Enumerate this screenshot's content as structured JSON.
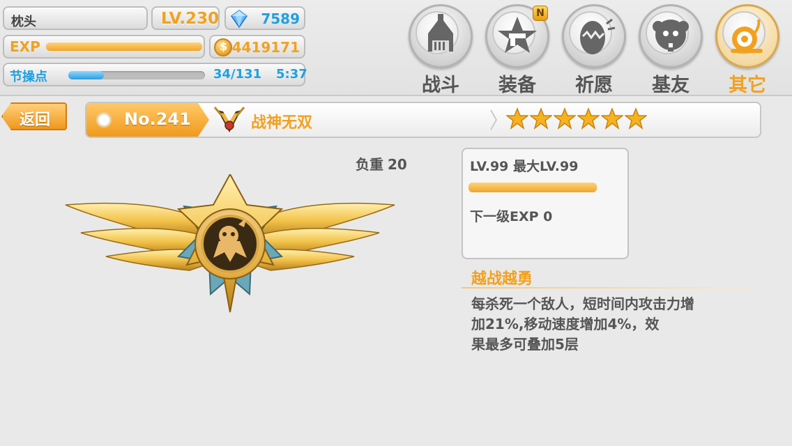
{
  "player": {
    "name": "枕头",
    "level": "LV.230",
    "gems": "7589",
    "exp_label": "EXP",
    "exp_progress": 1.0,
    "gold": "4419171",
    "stamina_label": "节操点",
    "stamina_progress": 0.26,
    "stamina_count": "34/131",
    "stamina_timer": "5:37"
  },
  "nav": {
    "items": [
      {
        "label": "战斗",
        "icon": "church-icon"
      },
      {
        "label": "装备",
        "icon": "star-gun-icon",
        "badge": "N"
      },
      {
        "label": "祈愿",
        "icon": "cracked-egg-icon"
      },
      {
        "label": "基友",
        "icon": "friend-face-icon"
      },
      {
        "label": "其它",
        "icon": "snail-icon",
        "active": true
      }
    ]
  },
  "header": {
    "back_label": "返回",
    "card_number": "No.241",
    "card_name": "战神无双",
    "rarity_stars": 6
  },
  "detail": {
    "weight_label": "负重",
    "weight_value": "20",
    "level_text": "LV.99 最大LV.99",
    "level_progress": 1.0,
    "next_exp_text": "下一级EXP 0",
    "skill_name": "越战越勇",
    "skill_desc_lines": [
      "每杀死一个敌人，短时间内攻击力增",
      "加21%,移动速度增加4%，效",
      "果最多可叠加5层"
    ]
  },
  "colors": {
    "accent_orange": "#f2a11e",
    "accent_blue": "#1fa0e0",
    "text_gray": "#555555"
  }
}
